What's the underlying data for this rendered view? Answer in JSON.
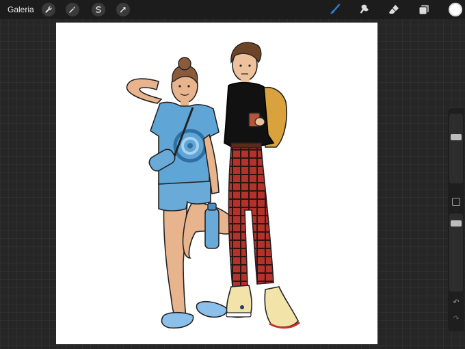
{
  "topbar": {
    "gallery_label": "Galeria",
    "left_tools": [
      {
        "name": "actions",
        "icon": "wrench-icon"
      },
      {
        "name": "adjustments",
        "icon": "magic-wand-icon"
      },
      {
        "name": "selection",
        "icon": "selection-s-icon"
      },
      {
        "name": "transform",
        "icon": "arrow-cursor-icon"
      }
    ],
    "right_tools": [
      {
        "name": "brush",
        "icon": "brush-icon",
        "active": true
      },
      {
        "name": "smudge",
        "icon": "smudge-icon"
      },
      {
        "name": "eraser",
        "icon": "eraser-icon"
      },
      {
        "name": "layers",
        "icon": "layers-icon"
      }
    ],
    "current_color": "#ffffff",
    "accent_color": "#2f7fe0"
  },
  "sidebar": {
    "brush_size_level": 0.85,
    "opacity_level": 0.15,
    "undo_icon": "undo-icon",
    "redo_icon": "redo-icon"
  },
  "canvas": {
    "background": "#ffffff",
    "artwork": "two-figures-illustration"
  }
}
